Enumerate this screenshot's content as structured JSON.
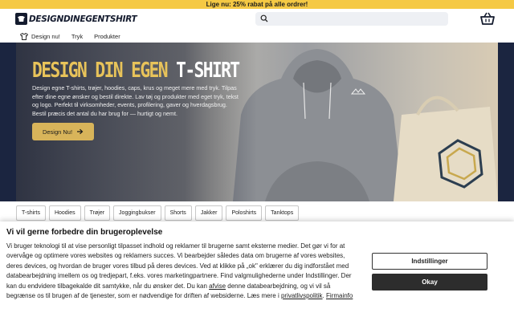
{
  "promo": {
    "text": "Lige nu: 25% rabat på alle ordrer!"
  },
  "header": {
    "logo_text": "DESIGNDINEGENTSHIRT",
    "search": {
      "placeholder": "",
      "icon": "search-icon"
    },
    "cart_icon": "basket-icon"
  },
  "nav": {
    "items": [
      {
        "label": "Design nu!",
        "icon": "shirt-icon"
      },
      {
        "label": "Tryk"
      },
      {
        "label": "Produkter"
      }
    ]
  },
  "hero": {
    "title_accent": "DESIGN DIN EGEN ",
    "title_white": "T-SHIRT",
    "text": "Design egne T-shirts, trøjer, hoodies, caps, krus og meget mere med tryk. Tilpas efter dine egne ønsker og bestil direkte. Lav tøj og produkter med eget tryk, tekst og logo. Perfekt til virksomheder, events, profilering, gaver og hverdagsbrug. Bestil præcis det antal du har brug for — hurtigt og nemt.",
    "button_label": "Design Nu!",
    "button_icon": "arrow-right-icon"
  },
  "categories": [
    "T-shirts",
    "Hoodies",
    "Trøjer",
    "Joggingbukser",
    "Shorts",
    "Jakker",
    "Poloshirts",
    "Tanktops"
  ],
  "consent": {
    "title": "Vi vil gerne forbedre din brugeroplevelse",
    "text_part1": "Vi bruger teknologi til at vise personligt tilpasset indhold og reklamer til brugerne samt eksterne medier. Det gør vi for at overvåge og optimere vores websites og reklamers succes. Vi bearbejder således data om brugerne af vores websites, deres devices, og hvordan de bruger vores tilbud på deres devices. Ved at klikke på „ok\" erklærer du dig indforstået med databearbejdning imellem os og tredjepart, f.eks. vores marketingpartnere. Find valgmulighederne under Indstillinger. Der kan du endvidere tilbagekalde dit samtykke, når du ønsker det. Du kan ",
    "link_afvise": "afvise",
    "text_part2": " denne databearbejdning, og vi vil så begrænse os til brugen af de tjenester, som er nødvendige for driften af websiderne. Læs mere i ",
    "link_privacy": "privatlivspolitik",
    "text_part3": ". ",
    "link_firma": "Firmainfo",
    "settings_label": "Indstillinger",
    "ok_label": "Okay"
  },
  "colors": {
    "accent": "#e8c35a",
    "promo_bg": "#f5c944",
    "brand_dark": "#141b2e",
    "button_dark": "#2d2d2d"
  }
}
